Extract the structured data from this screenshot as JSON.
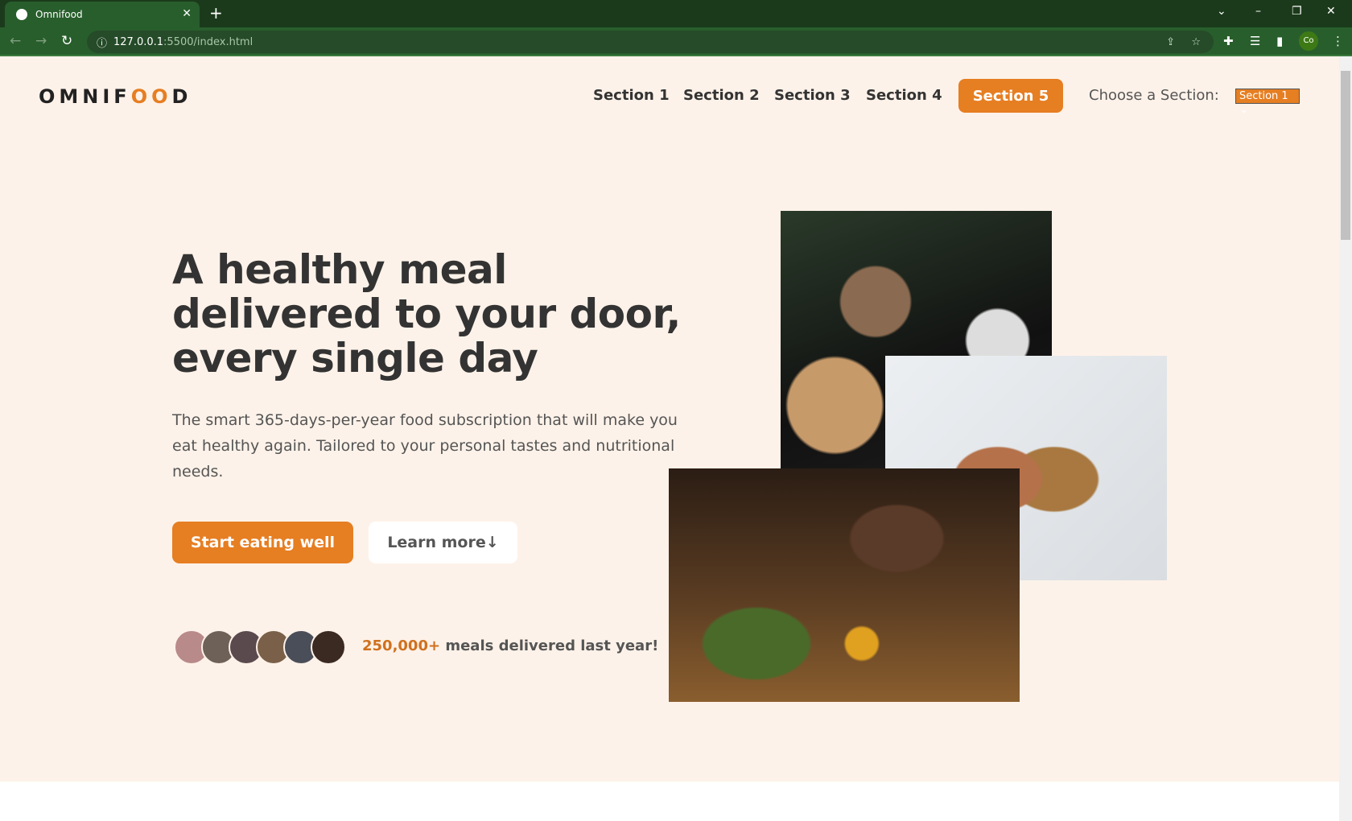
{
  "browser": {
    "tab_title": "Omnifood",
    "url_host": "127.0.0.1",
    "url_rest": ":5500/index.html",
    "profile": "Co"
  },
  "header": {
    "logo_pre": "OMNIF",
    "logo_oo": "OO",
    "logo_post": "D",
    "nav": [
      "Section 1",
      "Section 2",
      "Section 3",
      "Section 4"
    ],
    "cta": "Section 5",
    "choose_label": "Choose a Section:",
    "select_value": "Section 1"
  },
  "hero": {
    "title": "A healthy meal delivered to your door, every single day",
    "description": "The smart 365-days-per-year food subscription that will make you eat healthy again. Tailored to your personal tastes and nutritional needs.",
    "primary_button": "Start eating well",
    "secondary_button": "Learn more↓",
    "meals_count": "250,000+",
    "meals_text": " meals delivered last year!"
  },
  "colors": {
    "accent": "#e67e22",
    "hero_bg": "#fdf2e9"
  }
}
